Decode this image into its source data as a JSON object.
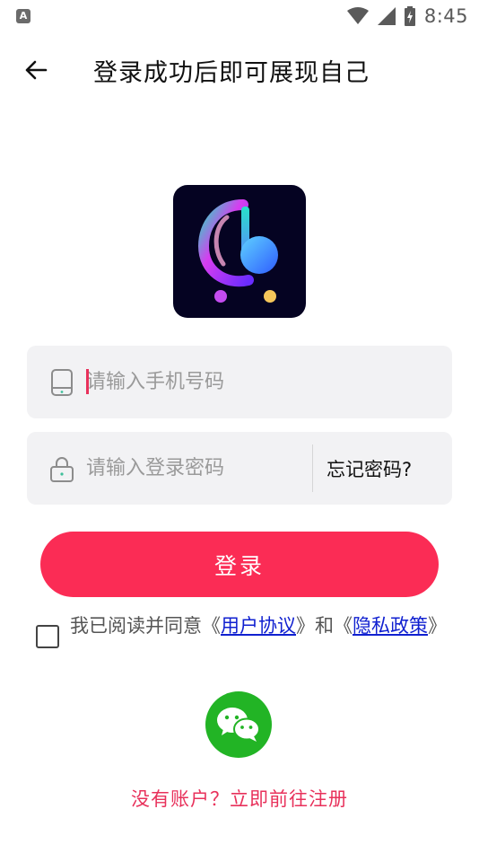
{
  "status_bar": {
    "time": "8:45",
    "app_badge": "A"
  },
  "header": {
    "title": "登录成功后即可展现自己"
  },
  "phone_field": {
    "placeholder": "请输入手机号码",
    "value": ""
  },
  "password_field": {
    "placeholder": "请输入登录密码",
    "value": ""
  },
  "forgot_password": "忘记密码?",
  "login_button": "登录",
  "agreement": {
    "checked": false,
    "prefix": "我已阅读并同意",
    "open1": "《",
    "user_agreement": "用户协议",
    "close1": "》",
    "and": "和",
    "open2": "《",
    "privacy_policy": "隐私政策",
    "close2": "》"
  },
  "register_link": "没有账户？立即前往注册",
  "colors": {
    "accent": "#fb2c55",
    "link": "#1020d0",
    "wechat": "#22b425",
    "field_bg": "#f2f2f4"
  }
}
